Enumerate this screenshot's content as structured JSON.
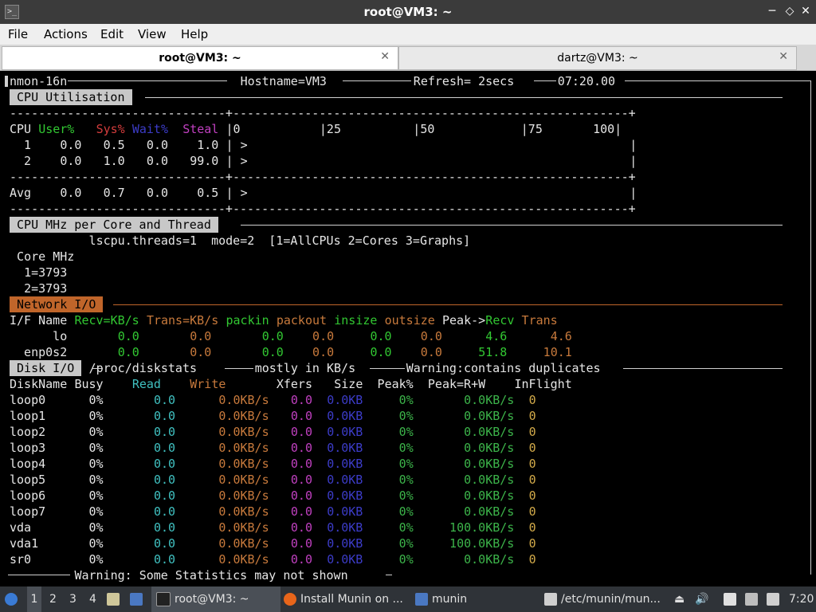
{
  "window": {
    "title": "root@VM3: ~"
  },
  "menu": [
    "File",
    "Actions",
    "Edit",
    "View",
    "Help"
  ],
  "tabs": [
    {
      "label": "root@VM3: ~"
    },
    {
      "label": "dartz@VM3: ~"
    }
  ],
  "header": {
    "version": "nmon-16n",
    "hostname": "Hostname=VM3",
    "refresh": "Refresh= 2secs",
    "time": "07:20.00"
  },
  "cpu": {
    "title": "CPU Utilisation",
    "col_cpu": "CPU",
    "col_user": "User%",
    "col_sys": "Sys%",
    "col_wait": "Wait%",
    "col_steal": "Steal",
    "scale": "|0           |25          |50            |75       100|",
    "rows": [
      {
        "id": "  1",
        "user": "0.0",
        "sys": "0.5",
        "wait": "0.0",
        "steal": "1.0",
        "bar": ">"
      },
      {
        "id": "  2",
        "user": "0.0",
        "sys": "1.0",
        "wait": "0.0",
        "steal": "99.0",
        "bar": ">"
      }
    ],
    "avg": {
      "id": "Avg",
      "user": "0.0",
      "sys": "0.7",
      "wait": "0.0",
      "steal": "0.5",
      "bar": ">"
    }
  },
  "mhz": {
    "title": "CPU MHz per Core and Thread",
    "info": "lscpu.threads=1  mode=2  [1=AllCPUs 2=Cores 3=Graphs]",
    "head": "Core MHz",
    "rows": [
      "1=3793",
      "2=3793"
    ]
  },
  "net": {
    "title": "Network I/O",
    "head": {
      "ifname": "I/F Name",
      "recv": "Recv=KB/s",
      "trans": "Trans=KB/s",
      "packin": "packin",
      "packout": "packout",
      "insize": "insize",
      "outsize": "outsize",
      "peak": "Peak->",
      "precv": "Recv",
      "ptrans": "Trans"
    },
    "rows": [
      {
        "name": "lo",
        "recv": "0.0",
        "trans": "0.0",
        "packin": "0.0",
        "packout": "0.0",
        "insize": "0.0",
        "outsize": "0.0",
        "peak_recv": "4.6",
        "peak_trans": "4.6"
      },
      {
        "name": "enp0s2",
        "recv": "0.0",
        "trans": "0.0",
        "packin": "0.0",
        "packout": "0.0",
        "insize": "0.0",
        "outsize": "0.0",
        "peak_recv": "51.8",
        "peak_trans": "10.1"
      }
    ]
  },
  "disk": {
    "title": "Disk I/O",
    "path": "/proc/diskstats",
    "unit": "mostly in KB/s",
    "warn": "Warning:contains duplicates",
    "head": {
      "name": "DiskName",
      "busy": "Busy",
      "read": "Read",
      "write": "Write",
      "xfers": "Xfers",
      "size": "Size",
      "peak": "Peak%",
      "peakrw": "Peak=R+W",
      "inflight": "InFlight"
    },
    "rows": [
      {
        "name": "loop0",
        "busy": "0%",
        "read": "0.0",
        "write": "0.0KB/s",
        "xfers": "0.0",
        "size": "0.0KB",
        "peak": "0%",
        "peakrw": "0.0KB/s",
        "inflight": "0"
      },
      {
        "name": "loop1",
        "busy": "0%",
        "read": "0.0",
        "write": "0.0KB/s",
        "xfers": "0.0",
        "size": "0.0KB",
        "peak": "0%",
        "peakrw": "0.0KB/s",
        "inflight": "0"
      },
      {
        "name": "loop2",
        "busy": "0%",
        "read": "0.0",
        "write": "0.0KB/s",
        "xfers": "0.0",
        "size": "0.0KB",
        "peak": "0%",
        "peakrw": "0.0KB/s",
        "inflight": "0"
      },
      {
        "name": "loop3",
        "busy": "0%",
        "read": "0.0",
        "write": "0.0KB/s",
        "xfers": "0.0",
        "size": "0.0KB",
        "peak": "0%",
        "peakrw": "0.0KB/s",
        "inflight": "0"
      },
      {
        "name": "loop4",
        "busy": "0%",
        "read": "0.0",
        "write": "0.0KB/s",
        "xfers": "0.0",
        "size": "0.0KB",
        "peak": "0%",
        "peakrw": "0.0KB/s",
        "inflight": "0"
      },
      {
        "name": "loop5",
        "busy": "0%",
        "read": "0.0",
        "write": "0.0KB/s",
        "xfers": "0.0",
        "size": "0.0KB",
        "peak": "0%",
        "peakrw": "0.0KB/s",
        "inflight": "0"
      },
      {
        "name": "loop6",
        "busy": "0%",
        "read": "0.0",
        "write": "0.0KB/s",
        "xfers": "0.0",
        "size": "0.0KB",
        "peak": "0%",
        "peakrw": "0.0KB/s",
        "inflight": "0"
      },
      {
        "name": "loop7",
        "busy": "0%",
        "read": "0.0",
        "write": "0.0KB/s",
        "xfers": "0.0",
        "size": "0.0KB",
        "peak": "0%",
        "peakrw": "0.0KB/s",
        "inflight": "0"
      },
      {
        "name": "vda",
        "busy": "0%",
        "read": "0.0",
        "write": "0.0KB/s",
        "xfers": "0.0",
        "size": "0.0KB",
        "peak": "0%",
        "peakrw": "100.0KB/s",
        "inflight": "0"
      },
      {
        "name": "vda1",
        "busy": "0%",
        "read": "0.0",
        "write": "0.0KB/s",
        "xfers": "0.0",
        "size": "0.0KB",
        "peak": "0%",
        "peakrw": "100.0KB/s",
        "inflight": "0"
      },
      {
        "name": "sr0",
        "busy": "0%",
        "read": "0.0",
        "write": "0.0KB/s",
        "xfers": "0.0",
        "size": "0.0KB",
        "peak": "0%",
        "peakrw": "0.0KB/s",
        "inflight": "0"
      }
    ]
  },
  "footer": {
    "warning": "Warning: Some Statistics may not shown"
  },
  "taskbar": {
    "workspaces": [
      "1",
      "2",
      "3",
      "4"
    ],
    "tasks": [
      "root@VM3: ~",
      "Install Munin on ...",
      "munin",
      "/etc/munin/mun..."
    ],
    "clock": "7:20"
  }
}
